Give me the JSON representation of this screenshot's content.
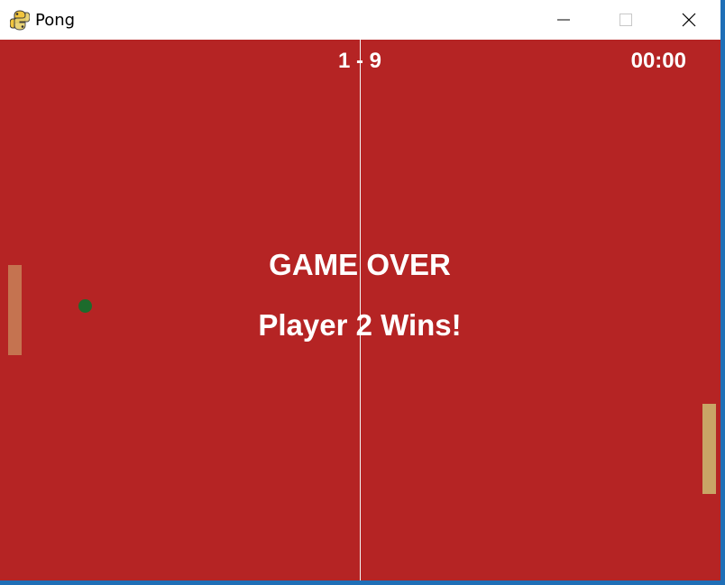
{
  "window": {
    "title": "Pong",
    "icon": "python-snake-icon"
  },
  "controls": {
    "minimize_icon": "minimize-icon",
    "maximize_icon": "maximize-icon",
    "close_icon": "close-icon"
  },
  "game": {
    "score": "1 - 9",
    "timer": "00:00",
    "status": "GAME OVER",
    "winner": "Player 2 Wins!"
  },
  "colors": {
    "background": "#b52424",
    "center_line": "#f4f4f4",
    "left_paddle": "#c57350",
    "right_paddle": "#c9a566",
    "ball": "#1d6b2c",
    "text": "#ffffff"
  }
}
